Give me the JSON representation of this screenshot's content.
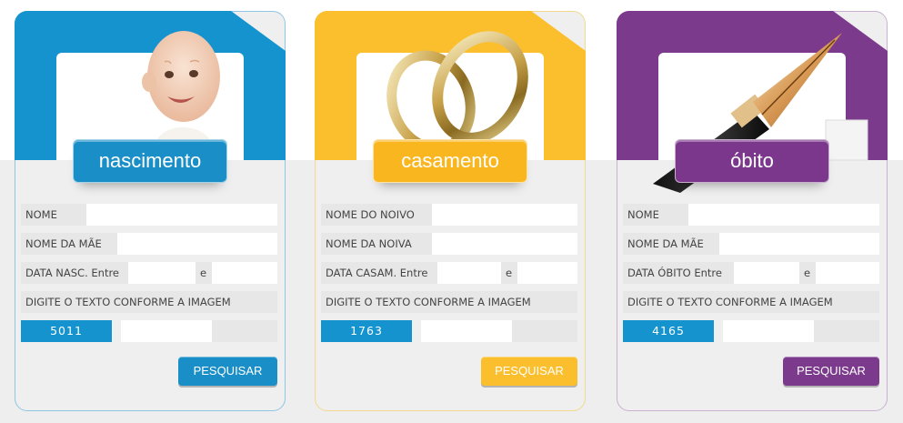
{
  "cards": {
    "nascimento": {
      "title": "nascimento",
      "fields": [
        "NOME",
        "NOME DA MÃE"
      ],
      "date_label": "DATA NASC. Entre",
      "date_sep": "e",
      "captcha_label": "DIGITE O TEXTO CONFORME A IMAGEM",
      "captcha_code": "5011",
      "search_label": "PESQUISAR",
      "color": "#1593cf"
    },
    "casamento": {
      "title": "casamento",
      "fields": [
        "NOME DO NOIVO",
        "NOME DA NOIVA"
      ],
      "date_label": "DATA CASAM. Entre",
      "date_sep": "e",
      "captcha_label": "DIGITE O TEXTO CONFORME A IMAGEM",
      "captcha_code": "1763",
      "search_label": "PESQUISAR",
      "color": "#fbbe2c"
    },
    "obito": {
      "title": "óbito",
      "fields": [
        "NOME",
        "NOME DA MÃE"
      ],
      "date_label": "DATA ÓBITO Entre",
      "date_sep": "e",
      "captcha_label": "DIGITE O TEXTO CONFORME A IMAGEM",
      "captcha_code": "4165",
      "search_label": "PESQUISAR",
      "color": "#7c3a8d"
    }
  }
}
